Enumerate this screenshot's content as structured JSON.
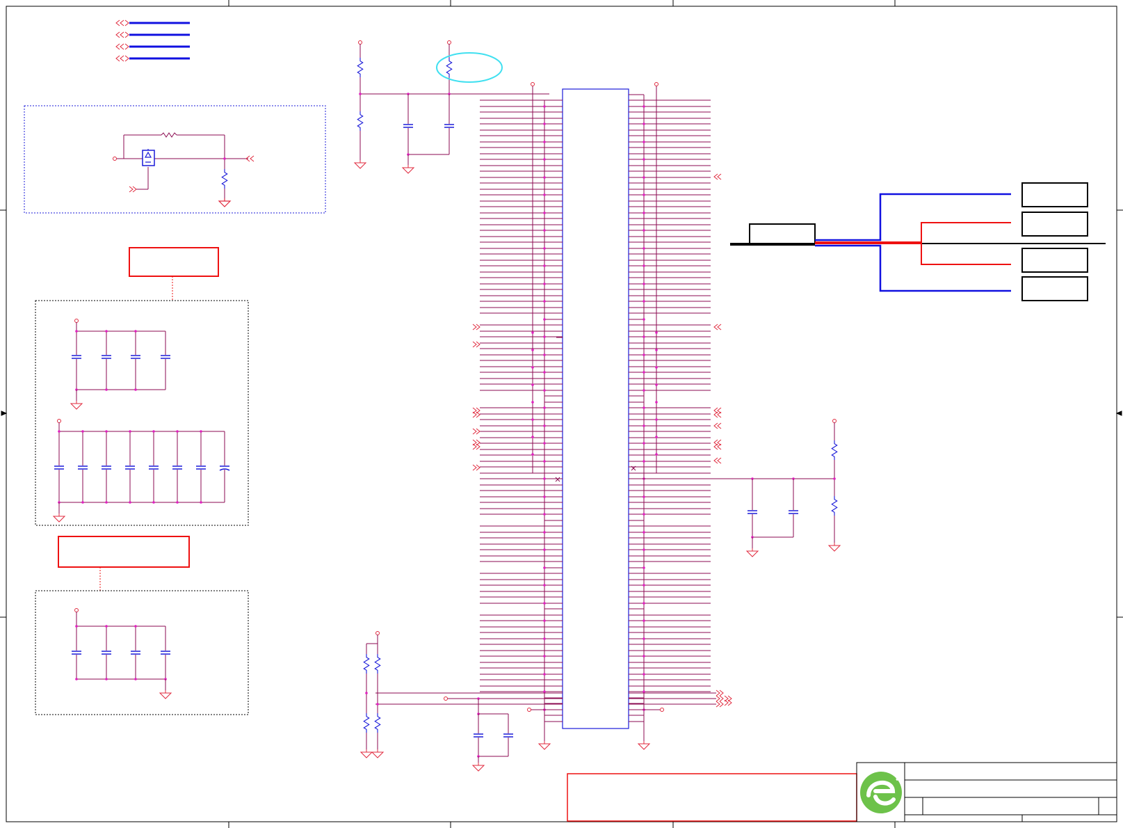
{
  "schematic": {
    "sheet_type": "electronic schematic",
    "colors": {
      "wire": "#8b0a50",
      "power_symbol": "#e0283c",
      "component": "#1a1ad8",
      "junction": "#e020c0",
      "bus_blue": "#1010e0",
      "bus_red": "#ee1111",
      "annotation_red": "#ee1111",
      "highlight": "#40e0f0",
      "frame": "#000000",
      "logo_green": "#6dc24a"
    },
    "logo_icon": "company-logo-e-icon",
    "components": {
      "main_connector": "connector-icon",
      "resistor": "resistor-icon",
      "capacitor": "capacitor-icon",
      "ground": "ground-icon",
      "power_port": "power-port-icon",
      "off_page_connector": "offpage-connector-icon",
      "diode": "diode-icon",
      "no_connect": "no-connect-icon"
    }
  }
}
